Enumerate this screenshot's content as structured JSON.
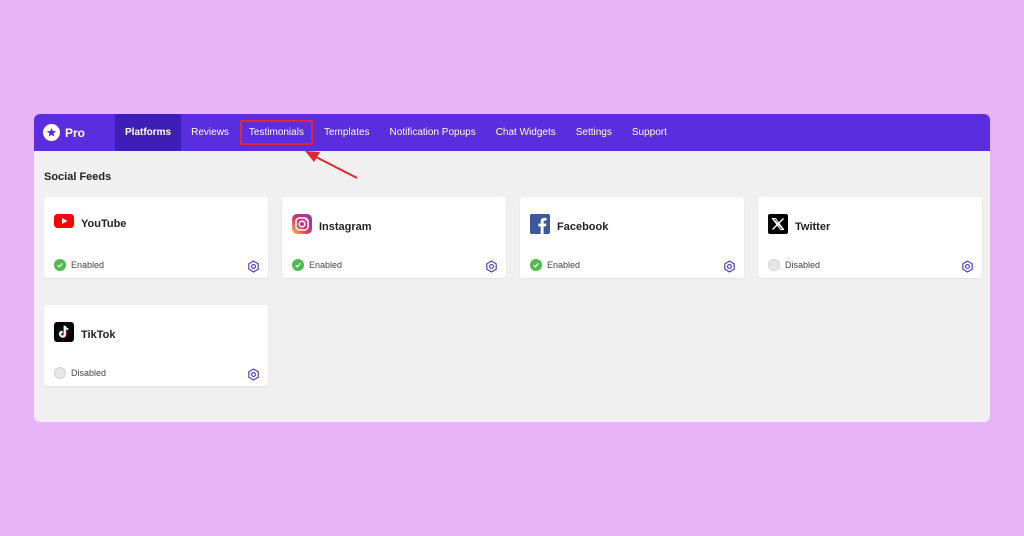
{
  "brand": {
    "name": "Pro"
  },
  "nav": {
    "items": [
      {
        "label": "Platforms",
        "active": true
      },
      {
        "label": "Reviews"
      },
      {
        "label": "Testimonials",
        "highlighted": true
      },
      {
        "label": "Templates"
      },
      {
        "label": "Notification Popups"
      },
      {
        "label": "Chat Widgets"
      },
      {
        "label": "Settings"
      },
      {
        "label": "Support"
      }
    ]
  },
  "section": {
    "title": "Social Feeds"
  },
  "platforms": [
    {
      "name": "YouTube",
      "icon": "youtube-icon",
      "status": "Enabled"
    },
    {
      "name": "Instagram",
      "icon": "instagram-icon",
      "status": "Enabled"
    },
    {
      "name": "Facebook",
      "icon": "facebook-icon",
      "status": "Enabled"
    },
    {
      "name": "Twitter",
      "icon": "x-twitter-icon",
      "status": "Disabled"
    },
    {
      "name": "TikTok",
      "icon": "tiktok-icon",
      "status": "Disabled"
    }
  ],
  "colors": {
    "background": "#e9b3f7",
    "nav_bar": "#5a2ddf",
    "nav_active": "#3d1fb5",
    "enabled": "#4fbb4d",
    "annotation": "#e5262a"
  }
}
